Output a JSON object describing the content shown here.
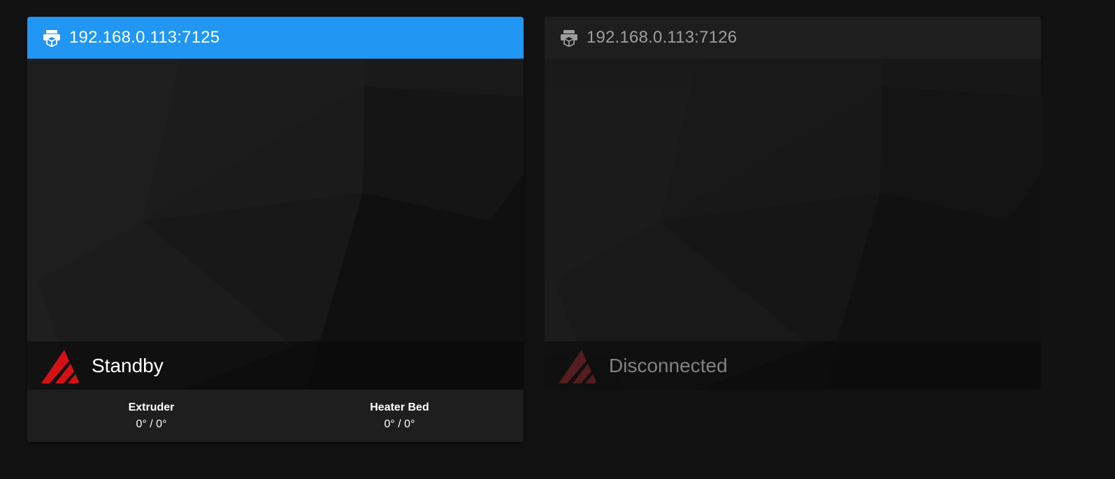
{
  "printers": [
    {
      "address": "192.168.0.113:7125",
      "icon": "printer-3d-icon",
      "status": "Standby",
      "logo": "mainsail-logo",
      "temps": [
        {
          "label": "Extruder",
          "value": "0° / 0°"
        },
        {
          "label": "Heater Bed",
          "value": "0° / 0°"
        }
      ]
    },
    {
      "address": "192.168.0.113:7126",
      "icon": "printer-3d-icon",
      "status": "Disconnected",
      "logo": "mainsail-logo"
    }
  ],
  "colors": {
    "background": "#121212",
    "card": "#1e1e1e",
    "active_header": "#2196f3",
    "logo_red": "#d41216",
    "logo_red_dim": "#5a1e20"
  }
}
